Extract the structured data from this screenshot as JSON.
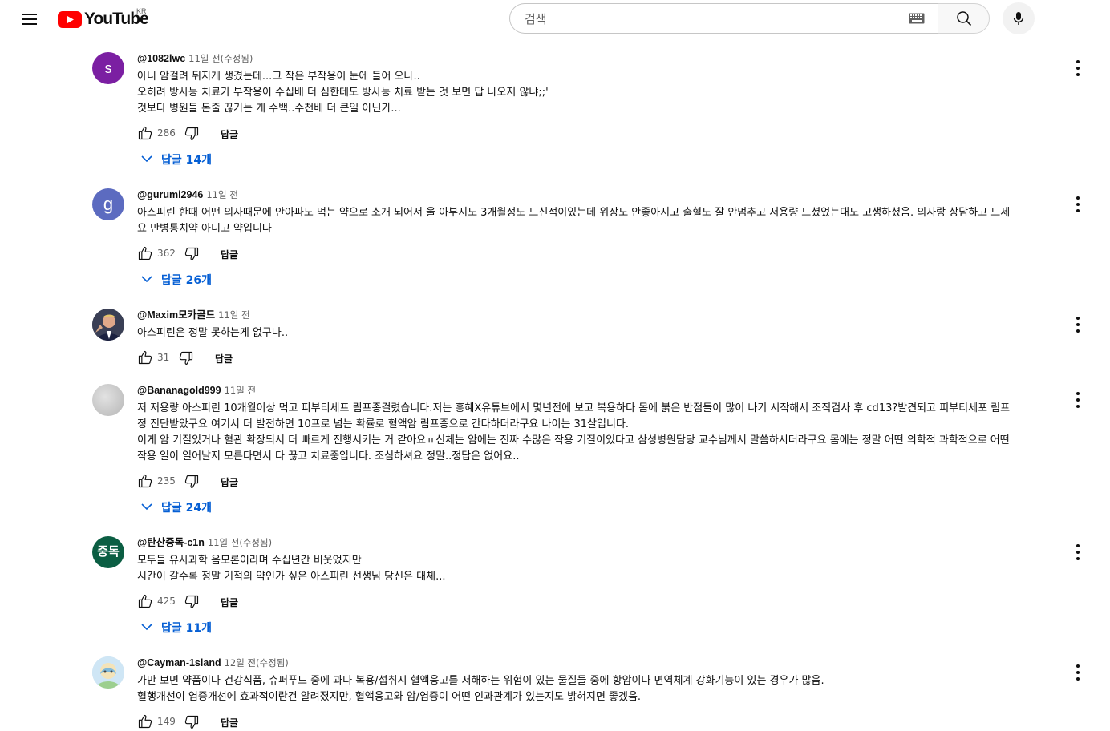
{
  "masthead": {
    "logo_text": "YouTube",
    "region": "KR",
    "search_placeholder": "검색",
    "icons": {
      "menu": "hamburger-menu-icon",
      "keyboard": "keyboard-icon",
      "search": "search-icon",
      "voice": "microphone-icon"
    }
  },
  "labels": {
    "reply": "답글"
  },
  "comments": [
    {
      "author": "@1082lwc",
      "time": "11일 전(수정됨)",
      "avatar_letter": "s",
      "avatar_color": "#7b1fa2",
      "lines": [
        "아니 암걸려 뒤지게 생겼는데...그 작은 부작용이 눈에 들어 오나..",
        "오히려 방사능 치료가 부작용이 수십배 더 심한데도 방사능 치료 받는 것 보면 답 나오지 않냐;;'",
        "것보다 병원들 돈줄 끊기는 게 수백..수천배 더 큰일 아닌가..."
      ],
      "likes": "286",
      "replies": "답글 14개"
    },
    {
      "author": "@gurumi2946",
      "time": "11일 전",
      "avatar_letter": "g",
      "avatar_color": "#5c6bc0",
      "lines": [
        "아스피린 한때 어떤 의사때문에 안아파도 먹는 약으로 소개 되어서 울 아부지도 3개월정도 드신적이있는데 위장도 안좋아지고 출혈도 잘 안멈추고 저용량 드셨었는대도 고생하셨음. 의사랑 상담하고 드세",
        "요 만병통치약 아니고 약입니다"
      ],
      "likes": "362",
      "replies": "답글 26개"
    },
    {
      "author": "@Maxim모카골드",
      "time": "11일 전",
      "avatar_letter": "",
      "avatar_color": "#2b2f3a",
      "lines": [
        "아스피린은 정말 못하는게 없구나.."
      ],
      "likes": "31",
      "replies": ""
    },
    {
      "author": "@Bananagold999",
      "time": "11일 전",
      "avatar_letter": "",
      "avatar_color": "#c8c8c8",
      "lines": [
        "저 저용량 아스피린 10개월이상 먹고 피부티세프 림프종걸렸습니다.저는 홍혜X유튜브에서 몇년전에 보고 복용하다 몸에 붉은 반점들이 많이 나기 시작해서 조직검사 후 cd13?발견되고 피부티세포 림프",
        "정 진단받았구요 여기서 더 발전하면 10프로 넘는 확률로 혈액암 림프종으로 간다하더라구요 나이는 31살입니다.",
        "이게 암 기질있거나 혈관 확장되서 더 빠르게 진행시키는 거 같아요ㅠ신체는 암에는 진짜 수많은 작용 기질이있다고 삼성병원담당 교수님께서 말씀하시더라구요 몸에는 정말 어떤 의학적 과학적으로 어떤",
        "작용 일이 일어날지 모른다면서 다 끊고 치료중입니다. 조심하셔요 정말..정답은 없어요.."
      ],
      "likes": "235",
      "replies": "답글 24개"
    },
    {
      "author": "@탄산중독-c1n",
      "time": "11일 전(수정됨)",
      "avatar_letter": "중독",
      "avatar_color": "#0b5e43",
      "lines": [
        "모두들 유사과학 음모론이라며 수십년간 비웃었지만",
        "시간이 갈수록 정말 기적의 약인가 싶은 아스피린 선생님 당신은 대체..."
      ],
      "likes": "425",
      "replies": "답글 11개"
    },
    {
      "author": "@Cayman-1sland",
      "time": "12일 전(수정됨)",
      "avatar_letter": "",
      "avatar_color": "#bcd7ea",
      "lines": [
        "가만 보면 약품이나 건강식품, 슈퍼푸드 중에 과다 복용/섭취시 혈액응고를 저해하는 위험이 있는 물질들 중에 항암이나 면역체계 강화기능이 있는 경우가 많음.",
        "혈행개선이 염증개선에 효과적이란건 알려졌지만, 혈액응고와 암/염증이 어떤 인과관계가 있는지도 밝혀지면 좋겠음."
      ],
      "likes": "149",
      "replies": ""
    }
  ]
}
